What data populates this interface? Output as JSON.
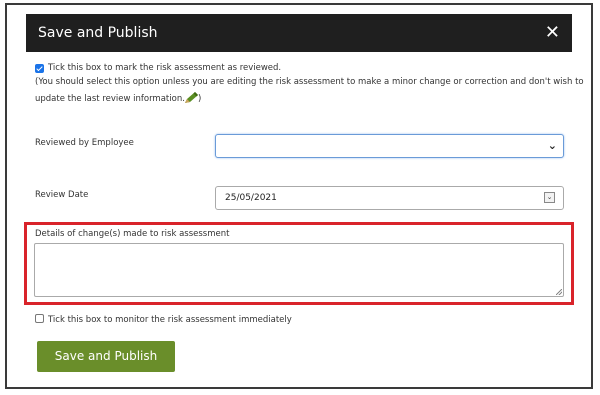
{
  "modal": {
    "title": "Save and Publish",
    "close_label": "✕"
  },
  "review_checkbox": {
    "checked": true,
    "label": "Tick this box to mark the risk assessment as reviewed.",
    "help_line1": "(You should select this option unless you are editing the risk assessment to make a minor change or correction and don't wish to",
    "help_line2": "update the last review information.",
    "help_line2_suffix": ")",
    "icon": "pencil-icon"
  },
  "reviewed_by": {
    "label": "Reviewed by Employee",
    "value": "",
    "arrow": "⌄"
  },
  "review_date": {
    "label": "Review Date",
    "value": "25/05/2021",
    "button_glyph": "⌄"
  },
  "details": {
    "label": "Details of change(s) made to risk assessment",
    "value": "",
    "highlight_color": "#d9232a"
  },
  "monitor_checkbox": {
    "checked": false,
    "label": "Tick this box to monitor the risk assessment immediately"
  },
  "actions": {
    "publish_label": "Save and Publish",
    "publish_color": "#6a8e2a"
  }
}
